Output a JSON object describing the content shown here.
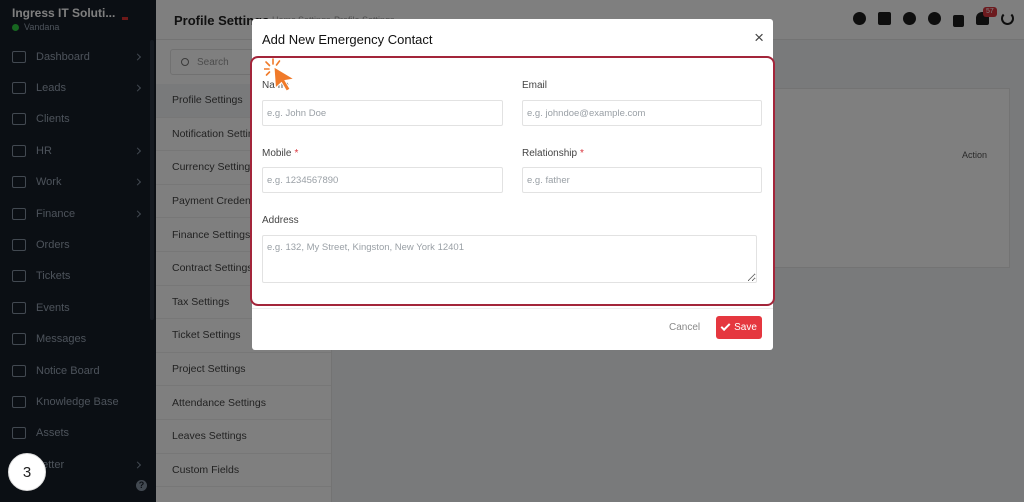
{
  "brand": {
    "name": "Ingress IT Soluti...",
    "user": "Vandana"
  },
  "sidebar": {
    "items": [
      {
        "label": "Dashboard",
        "icon": "home-icon",
        "has_children": true
      },
      {
        "label": "Leads",
        "icon": "id-card-icon",
        "has_children": true
      },
      {
        "label": "Clients",
        "icon": "building-icon",
        "has_children": false
      },
      {
        "label": "HR",
        "icon": "people-icon",
        "has_children": true
      },
      {
        "label": "Work",
        "icon": "briefcase-icon",
        "has_children": true
      },
      {
        "label": "Finance",
        "icon": "dollar-icon",
        "has_children": true
      },
      {
        "label": "Orders",
        "icon": "cart-icon",
        "has_children": false
      },
      {
        "label": "Tickets",
        "icon": "headset-icon",
        "has_children": false
      },
      {
        "label": "Events",
        "icon": "calendar-icon",
        "has_children": false
      },
      {
        "label": "Messages",
        "icon": "chat-icon",
        "has_children": false
      },
      {
        "label": "Notice Board",
        "icon": "clipboard-icon",
        "has_children": false
      },
      {
        "label": "Knowledge Base",
        "icon": "book-icon",
        "has_children": false
      },
      {
        "label": "Assets",
        "icon": "monitor-icon",
        "has_children": false
      },
      {
        "label": "Letter",
        "icon": "letter-icon",
        "has_children": true
      }
    ]
  },
  "header": {
    "title": "Profile Settings",
    "crumbs": [
      "Home",
      "Settings",
      "Profile Settings"
    ],
    "notification_count": "57"
  },
  "submenu": {
    "search_placeholder": "Search",
    "items": [
      {
        "label": "Profile Settings",
        "active": true
      },
      {
        "label": "Notification Settings",
        "active": false
      },
      {
        "label": "Currency Settings",
        "active": false
      },
      {
        "label": "Payment Credentials",
        "active": false
      },
      {
        "label": "Finance Settings",
        "active": false
      },
      {
        "label": "Contract Settings",
        "active": false
      },
      {
        "label": "Tax Settings",
        "active": false
      },
      {
        "label": "Ticket Settings",
        "active": false
      },
      {
        "label": "Project Settings",
        "active": false
      },
      {
        "label": "Attendance Settings",
        "active": false
      },
      {
        "label": "Leaves Settings",
        "active": false
      },
      {
        "label": "Custom Fields",
        "active": false
      }
    ]
  },
  "main": {
    "action_header": "Action"
  },
  "modal": {
    "title": "Add New Emergency Contact",
    "close_glyph": "×",
    "fields": {
      "name": {
        "label": "Name",
        "placeholder": "e.g. John Doe",
        "value": ""
      },
      "email": {
        "label": "Email",
        "placeholder": "e.g. johndoe@example.com",
        "value": ""
      },
      "mobile": {
        "label": "Mobile",
        "required_mark": "*",
        "placeholder": "e.g. 1234567890",
        "value": ""
      },
      "relationship": {
        "label": "Relationship",
        "required_mark": "*",
        "placeholder": "e.g. father",
        "value": ""
      },
      "address": {
        "label": "Address",
        "placeholder": "e.g. 132, My Street, Kingston, New York 12401",
        "value": ""
      }
    },
    "cancel_label": "Cancel",
    "save_label": "Save"
  },
  "step_badge": "3",
  "colors": {
    "accent": "#e5373f",
    "highlight": "#a3253a",
    "sidebar": "#171f29",
    "pointer": "#f07a2a"
  }
}
